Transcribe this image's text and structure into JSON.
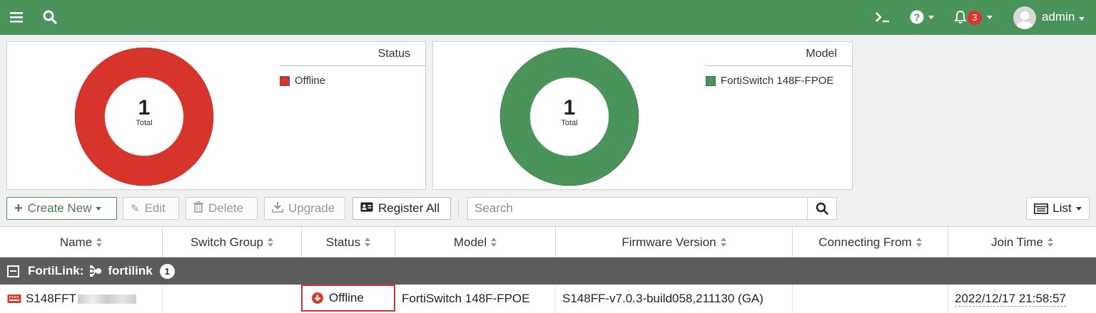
{
  "header": {
    "menu_icon": "hamburger-icon",
    "search_icon": "search-icon",
    "cli_icon": "terminal-icon",
    "help_icon": "help-circle-icon",
    "bell_icon": "bell-icon",
    "notification_count": "3",
    "user": "admin"
  },
  "charts": [
    {
      "legend_title": "Status",
      "total": "1",
      "total_label": "Total",
      "legend": [
        "Offline"
      ],
      "color": "#d7352b"
    },
    {
      "legend_title": "Model",
      "total": "1",
      "total_label": "Total",
      "legend": [
        "FortiSwitch 148F-FPOE"
      ],
      "color": "#4a935a"
    }
  ],
  "chart_data": [
    {
      "type": "pie",
      "categories": [
        "Offline"
      ],
      "values": [
        1
      ],
      "title": "Status"
    },
    {
      "type": "pie",
      "categories": [
        "FortiSwitch 148F-FPOE"
      ],
      "values": [
        1
      ],
      "title": "Model"
    }
  ],
  "toolbar": {
    "create_new": "Create New",
    "edit": "Edit",
    "delete": "Delete",
    "upgrade": "Upgrade",
    "register_all": "Register All",
    "search_placeholder": "Search",
    "view": "List"
  },
  "table": {
    "columns": [
      "Name",
      "Switch Group",
      "Status",
      "Model",
      "Firmware Version",
      "Connecting From",
      "Join Time"
    ],
    "group": {
      "label": "FortiLink:",
      "name": "fortilink",
      "count": "1"
    },
    "rows": [
      {
        "name": "S148FFT",
        "switch_group": "",
        "status": "Offline",
        "model": "FortiSwitch 148F-FPOE",
        "firmware": "S148FF-v7.0.3-build058,211130 (GA)",
        "connecting_from": "",
        "join_time": "2022/12/17 21:58:57"
      }
    ]
  }
}
